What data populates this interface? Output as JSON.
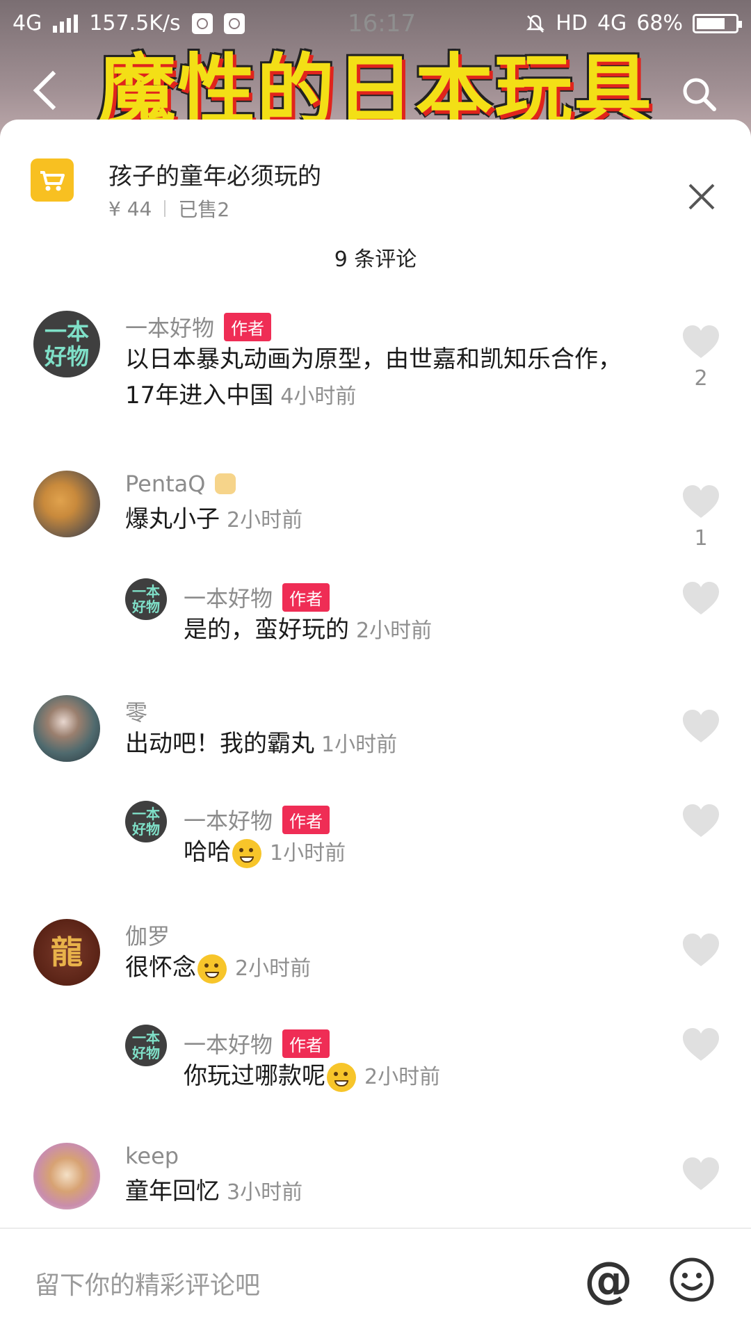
{
  "status_bar": {
    "network": "4G",
    "speed": "157.5K/s",
    "time": "16:17",
    "hd": "HD",
    "network2": "4G",
    "battery": "68%"
  },
  "video": {
    "title": "魔性的日本玩具"
  },
  "product": {
    "title": "孩子的童年必须玩的",
    "price": "¥ 44",
    "sold": "已售2"
  },
  "comment_count": "9 条评论",
  "comments": [
    {
      "avatar_text": "一本好物",
      "name": "一本好物",
      "badge": "作者",
      "text": "以日本暴丸动画为原型，由世嘉和凯知乐合作，17年进入中国",
      "time": "4小时前",
      "likes": "2"
    },
    {
      "name": "PentaQ",
      "text": "爆丸小子",
      "time": "2小时前",
      "likes": "1"
    },
    {
      "avatar_text": "一本好物",
      "name": "一本好物",
      "badge": "作者",
      "text": "是的，蛮好玩的",
      "time": "2小时前"
    },
    {
      "name": "零",
      "text": "出动吧！我的霸丸",
      "time": "1小时前"
    },
    {
      "avatar_text": "一本好物",
      "name": "一本好物",
      "badge": "作者",
      "text": "哈哈",
      "time": "1小时前"
    },
    {
      "avatar_text": "龍",
      "name": "伽罗",
      "text": "很怀念",
      "time": "2小时前"
    },
    {
      "avatar_text": "一本好物",
      "name": "一本好物",
      "badge": "作者",
      "text": "你玩过哪款呢",
      "time": "2小时前"
    },
    {
      "name": "keep",
      "text": "童年回忆",
      "time": "3小时前"
    }
  ],
  "input": {
    "placeholder": "留下你的精彩评论吧"
  },
  "colors": {
    "accent": "#ef2d55",
    "cart": "#f8c021",
    "title_yellow": "#f3df16"
  },
  "icons": [
    "back-icon",
    "search-icon",
    "cart-icon",
    "close-icon",
    "heart-icon",
    "at-icon",
    "smile-icon"
  ]
}
